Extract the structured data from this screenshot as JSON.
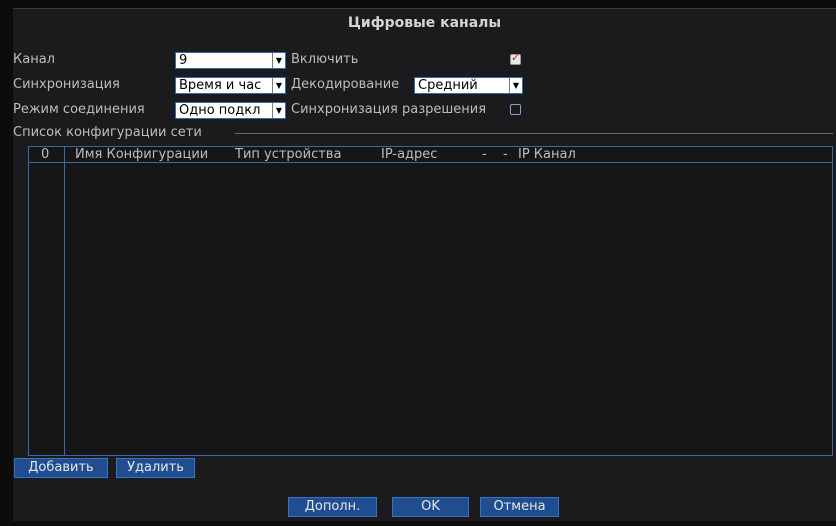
{
  "dialog": {
    "title": "Цифровые каналы"
  },
  "form": {
    "channel_label": "Канал",
    "channel_value": "9",
    "enable_label": "Включить",
    "enable_checked": true,
    "sync_label": "Синхронизация",
    "sync_value": "Время и час",
    "decode_label": "Декодирование",
    "decode_value": "Средний",
    "mode_label": "Режим соединения",
    "mode_value": "Одно подкл",
    "res_sync_label": "Синхронизация разрешения",
    "res_sync_checked": false
  },
  "config_list": {
    "group_label": "Список конфигурации сети",
    "columns": [
      "0",
      "Имя Конфигурации",
      "Тип устройства",
      "IP-адрес",
      "-",
      "-",
      "IP Канал"
    ],
    "rows": []
  },
  "buttons": {
    "add": "Добавить",
    "delete": "Удалить",
    "advanced": "Дополн.",
    "ok": "OK",
    "cancel": "Отмена"
  },
  "icons": {
    "dropdown": "chevron-down-icon",
    "checkbox": "checkmark-icon"
  }
}
